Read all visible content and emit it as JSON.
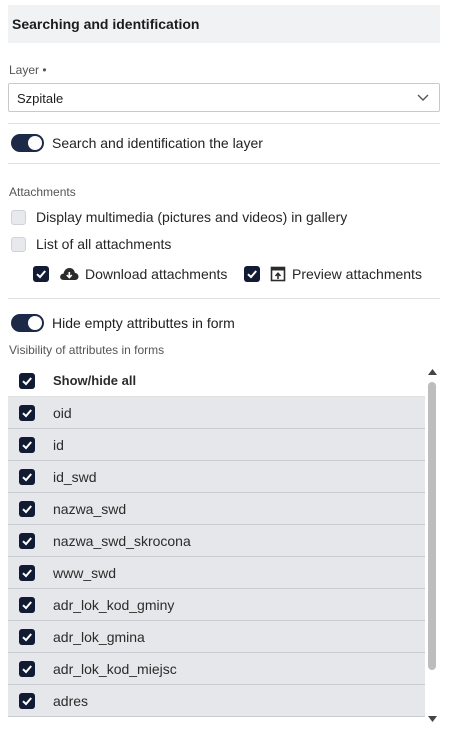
{
  "section": {
    "title": "Searching and identification"
  },
  "layer": {
    "label": "Layer •",
    "value": "Szpitale"
  },
  "search_toggle": {
    "label": "Search and identification the layer",
    "on": true
  },
  "attachments": {
    "label": "Attachments",
    "display_multimedia": {
      "label": "Display multimedia (pictures and videos) in gallery",
      "checked": false
    },
    "list_all": {
      "label": "List of all attachments",
      "checked": false
    },
    "download": {
      "label": "Download attachments",
      "checked": true
    },
    "preview": {
      "label": "Preview attachments",
      "checked": true
    }
  },
  "hide_empty_toggle": {
    "label": "Hide empty attributtes in form",
    "on": true
  },
  "visibility": {
    "label": "Visibility of attributes in forms",
    "show_hide_all": "Show/hide all",
    "attributes": [
      "oid",
      "id",
      "id_swd",
      "nazwa_swd",
      "nazwa_swd_skrocona",
      "www_swd",
      "adr_lok_kod_gminy",
      "adr_lok_gmina",
      "adr_lok_kod_miejsc",
      "adres"
    ]
  },
  "colors": {
    "toggle_on": "#1c2a48",
    "checkbox": "#111b33",
    "row_bg": "#e6e7ea",
    "header_bg": "#f1f2f4"
  }
}
